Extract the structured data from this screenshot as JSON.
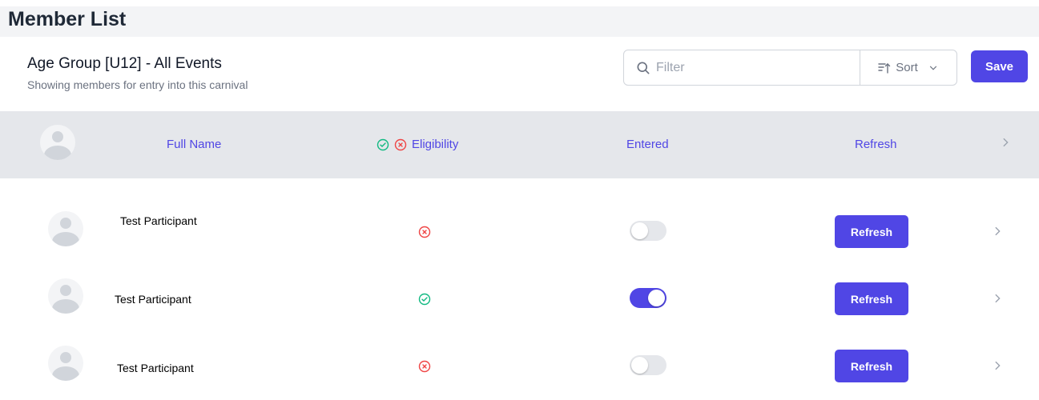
{
  "page": {
    "title": "Member List"
  },
  "subheader": {
    "title": "Age Group [U12] - All Events",
    "description": "Showing members for entry into this carnival"
  },
  "toolbar": {
    "filter_placeholder": "Filter",
    "sort_label": "Sort",
    "save_label": "Save"
  },
  "table": {
    "columns": {
      "full_name": "Full Name",
      "eligibility": "Eligibility",
      "entered": "Entered",
      "refresh": "Refresh"
    },
    "rows": [
      {
        "name": "Test Participant",
        "eligible": false,
        "entered": false,
        "refresh_label": "Refresh"
      },
      {
        "name": "Test Participant",
        "eligible": true,
        "entered": true,
        "refresh_label": "Refresh"
      },
      {
        "name": "Test Participant",
        "eligible": false,
        "entered": false,
        "refresh_label": "Refresh"
      }
    ]
  },
  "icons": {
    "search": "search-icon",
    "sort": "sort-icon",
    "chevron_down": "chevron-down-icon",
    "chevron_right": "chevron-right-icon",
    "check_circle": "check-circle-icon",
    "x_circle": "x-circle-icon",
    "avatar": "user-avatar-icon"
  },
  "colors": {
    "accent": "#5046e5",
    "success": "#10b981",
    "error": "#ef4444",
    "header_bg": "#e5e7eb"
  }
}
